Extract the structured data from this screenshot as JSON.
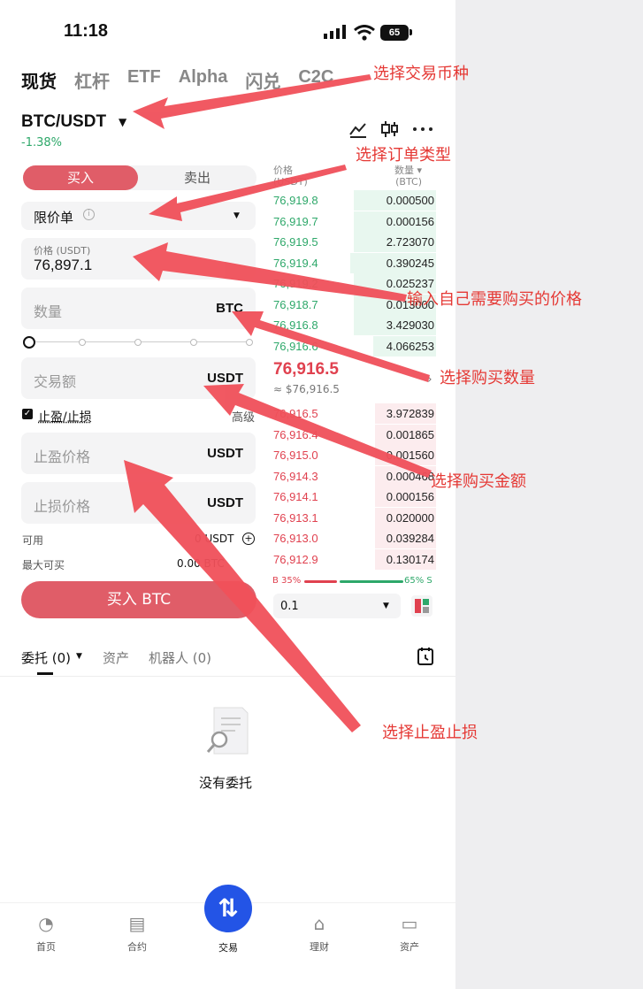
{
  "status": {
    "time": "11:18",
    "battery": "65"
  },
  "tabs": [
    "现货",
    "杠杆",
    "ETF",
    "Alpha",
    "闪兑",
    "C2C"
  ],
  "pair": {
    "name": "BTC/USDT",
    "change": "-1.38%"
  },
  "order": {
    "buy_label": "买入",
    "sell_label": "卖出",
    "type": "限价单",
    "price_label": "价格 (USDT)",
    "price_value": "76,897.1",
    "qty_placeholder": "数量",
    "qty_unit": "BTC",
    "amount_placeholder": "交易额",
    "amount_unit": "USDT",
    "tpsl_label": "止盈/止损",
    "advanced_label": "高级",
    "tp_placeholder": "止盈价格",
    "tp_unit": "USDT",
    "sl_placeholder": "止损价格",
    "sl_unit": "USDT",
    "available_label": "可用",
    "available_value": "0 USDT",
    "max_label": "最大可买",
    "max_value": "0.00 BTC",
    "submit_label": "买入 BTC"
  },
  "orderbook": {
    "price_header": "价格\n(USDT)",
    "qty_header": "数量 ▾\n(BTC)",
    "asks": [
      {
        "price": "76,919.8",
        "amount": "0.000500",
        "depth": 0.5
      },
      {
        "price": "76,919.7",
        "amount": "0.000156",
        "depth": 0.5
      },
      {
        "price": "76,919.5",
        "amount": "2.723070",
        "depth": 0.5
      },
      {
        "price": "76,919.4",
        "amount": "0.390245",
        "depth": 0.52
      },
      {
        "price": "76,919.2",
        "amount": "0.025237",
        "depth": 0.5
      },
      {
        "price": "76,918.7",
        "amount": "0.013000",
        "depth": 0.5
      },
      {
        "price": "76,916.8",
        "amount": "3.429030",
        "depth": 0.5
      },
      {
        "price": "76,916.6",
        "amount": "4.066253",
        "depth": 0.38
      }
    ],
    "mid_price": "76,916.5",
    "mid_usd": "≈ $76,916.5",
    "bids": [
      {
        "price": "76,916.5",
        "amount": "3.972839",
        "depth": 0.37
      },
      {
        "price": "76,916.4",
        "amount": "0.001865",
        "depth": 0.37
      },
      {
        "price": "76,915.0",
        "amount": "0.001560",
        "depth": 0.37
      },
      {
        "price": "76,914.3",
        "amount": "0.000468",
        "depth": 0.37
      },
      {
        "price": "76,914.1",
        "amount": "0.000156",
        "depth": 0.37
      },
      {
        "price": "76,913.1",
        "amount": "0.020000",
        "depth": 0.37
      },
      {
        "price": "76,913.0",
        "amount": "0.039284",
        "depth": 0.37
      },
      {
        "price": "76,912.9",
        "amount": "0.130174",
        "depth": 0.37
      }
    ],
    "buy_ratio": "B 35%",
    "sell_ratio": "65% S",
    "precision": "0.1"
  },
  "bottom_tabs": {
    "orders": "委托 (0)",
    "assets": "资产",
    "bots": "机器人 (0)"
  },
  "empty_text": "没有委托",
  "nav": [
    "首页",
    "合约",
    "交易",
    "理财",
    "资产"
  ],
  "annotations": {
    "select_pair": "选择交易币种",
    "select_type": "选择订单类型",
    "input_price": "输入自己需要购买的价格",
    "select_qty": "选择购买数量",
    "select_amount": "选择购买金额",
    "select_tpsl": "选择止盈止损"
  }
}
